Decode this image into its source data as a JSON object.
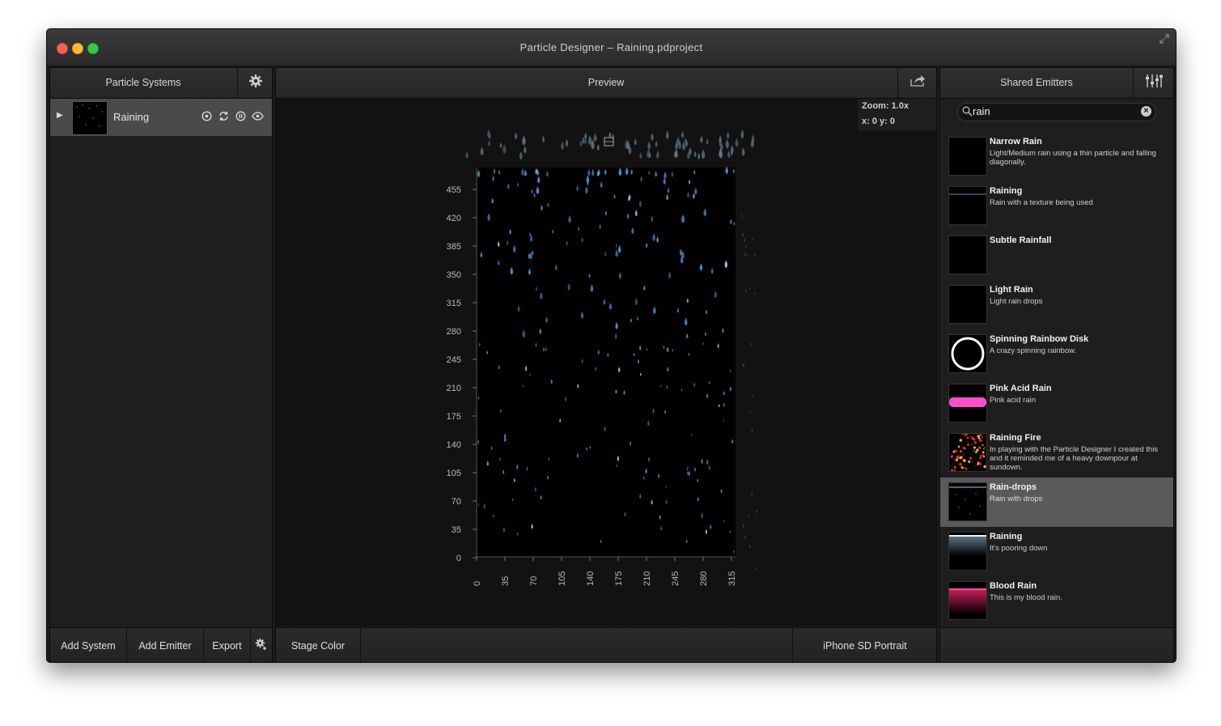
{
  "window": {
    "title": "Particle Designer – Raining.pdproject"
  },
  "left_panel": {
    "header": "Particle Systems",
    "systems": [
      {
        "name": "Raining"
      }
    ],
    "footer": {
      "add_system": "Add System",
      "add_emitter": "Add Emitter",
      "export": "Export"
    }
  },
  "preview": {
    "header": "Preview",
    "zoom": "Zoom: 1.0x",
    "coords": "x: 0 y: 0",
    "footer": {
      "stage_color": "Stage Color",
      "device": "iPhone SD Portrait"
    },
    "x_ticks": [
      "0",
      "35",
      "70",
      "105",
      "140",
      "175",
      "210",
      "245",
      "280",
      "315"
    ],
    "y_ticks": [
      "455",
      "420",
      "385",
      "350",
      "315",
      "280",
      "245",
      "210",
      "175",
      "140",
      "105",
      "70",
      "35",
      "0"
    ]
  },
  "right_panel": {
    "header": "Shared Emitters",
    "search_value": "rain",
    "emitters": [
      {
        "title": "Narrow Rain",
        "desc": "Light/Medium rain using a thin particle and falling diagonally."
      },
      {
        "title": "Raining",
        "desc": "Rain with a texture being used"
      },
      {
        "title": "Subtle Rainfall",
        "desc": ""
      },
      {
        "title": "Light Rain",
        "desc": "Light rain drops"
      },
      {
        "title": "Spinning Rainbow Disk",
        "desc": "A crazy spinning rainbow."
      },
      {
        "title": "Pink Acid Rain",
        "desc": "Pink acid rain"
      },
      {
        "title": "Raining Fire",
        "desc": "In playing with the Particle Designer I created this and it reminded me of a heavy downpour at sundown."
      },
      {
        "title": "Rain-drops",
        "desc": "Rain with drops"
      },
      {
        "title": "Raining",
        "desc": "It's pooring down"
      },
      {
        "title": "Blood Rain",
        "desc": "This is my blood rain."
      }
    ]
  },
  "colors": {
    "selected_row": "#5a5a5a",
    "rain_drop": "#5b9fd6",
    "pink": "#ff4fc8",
    "blood": "#e0185a",
    "fire": "#e0301a"
  }
}
